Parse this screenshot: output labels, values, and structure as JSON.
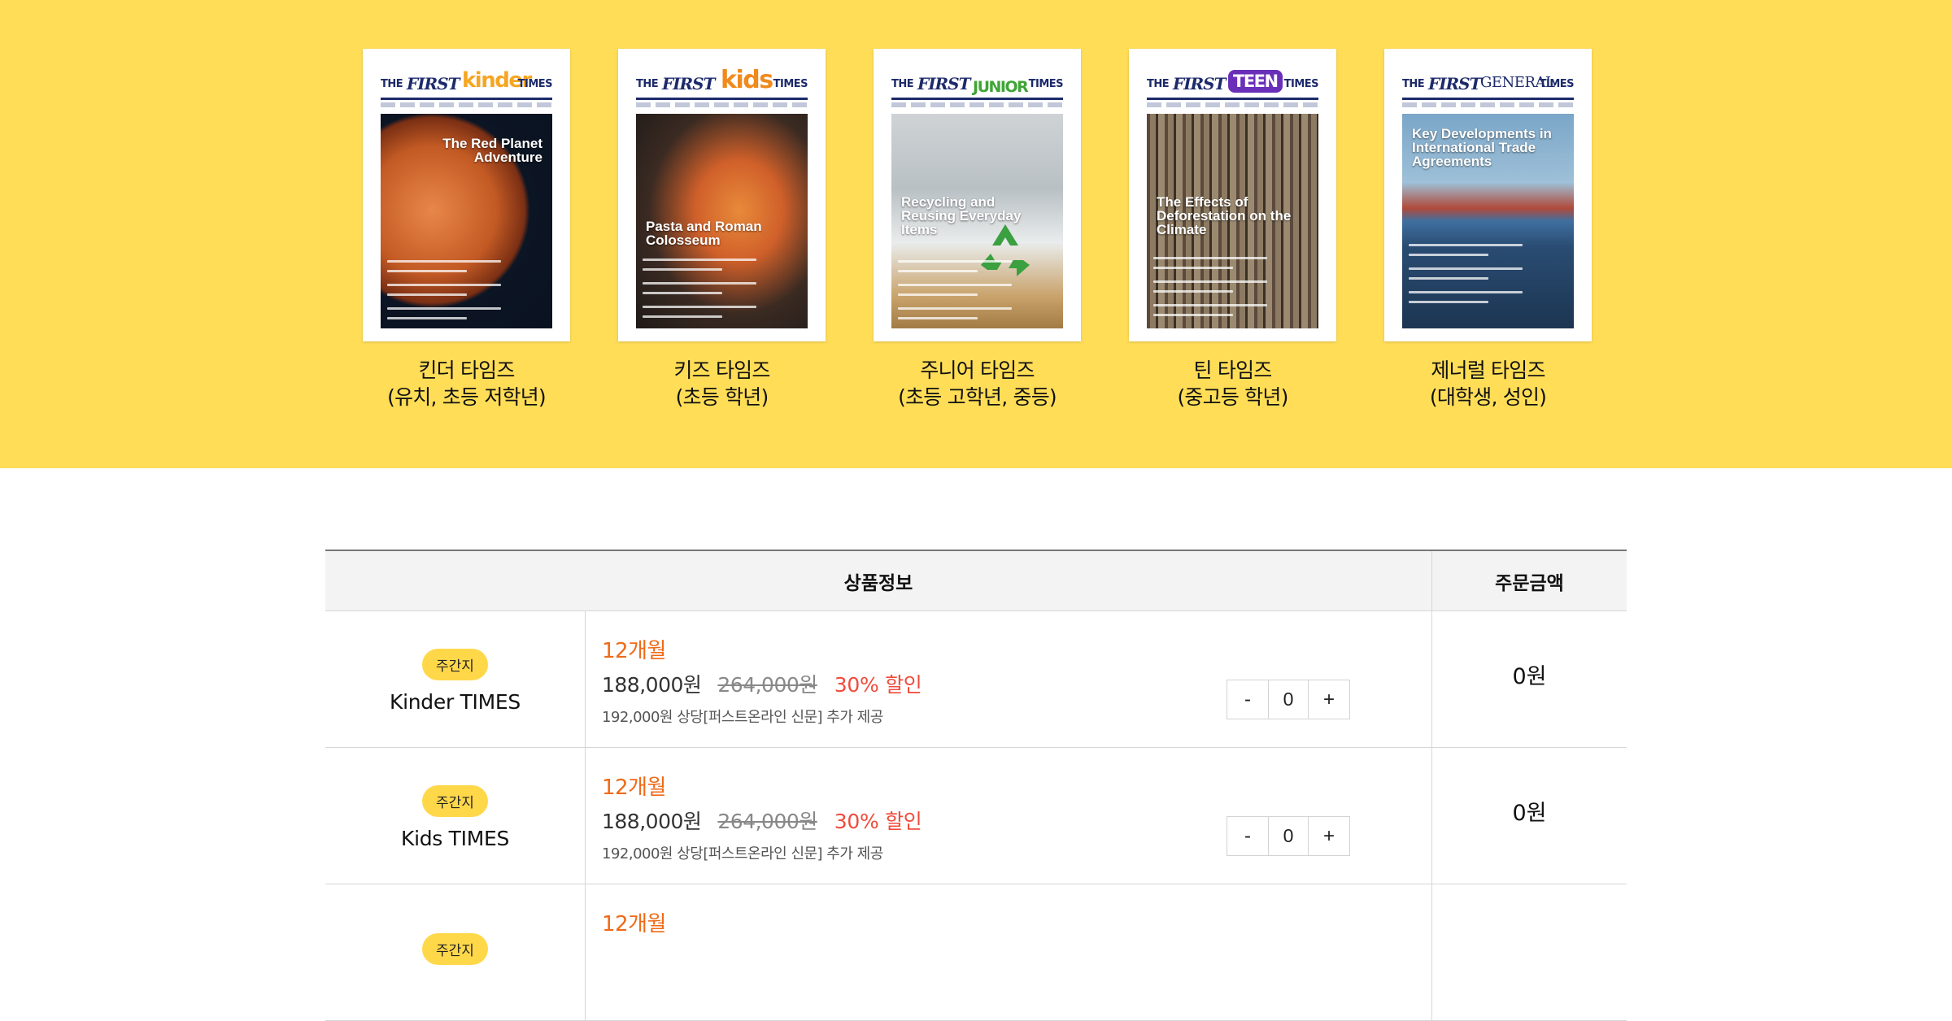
{
  "covers": [
    {
      "brand": "kinder",
      "brand_color": "#f5a623",
      "headline": "The Red Planet Adventure",
      "name": "킨더 타임즈",
      "audience": "(유치, 초등 저학년)"
    },
    {
      "brand": "kids",
      "brand_color": "#f08a1c",
      "headline": "Pasta and Roman Colosseum",
      "name": "키즈 타임즈",
      "audience": "(초등 학년)"
    },
    {
      "brand": "JUNIOR",
      "brand_color": "#3fa535",
      "headline": "Recycling and Reusing Everyday Items",
      "name": "주니어 타임즈",
      "audience": "(초등 고학년, 중등)"
    },
    {
      "brand": "TEEN",
      "brand_color": "#6a2fb8",
      "headline": "The Effects of Deforestation on the Climate",
      "name": "틴 타임즈",
      "audience": "(중고등 학년)"
    },
    {
      "brand": "GENERAL",
      "brand_color": "#1d2a6b",
      "headline": "Key Developments in International Trade Agreements",
      "name": "제너럴 타임즈",
      "audience": "(대학생, 성인)"
    }
  ],
  "masthead": {
    "the": "THE",
    "first": "FIRST",
    "times": "TIMES"
  },
  "table": {
    "col_info": "상품정보",
    "col_price": "주문금액",
    "rows": [
      {
        "badge": "주간지",
        "name": "Kinder TIMES",
        "plan": "12개월",
        "price": "188,000원",
        "original_price": "264,000원",
        "discount": "30% 할인",
        "bonus": "192,000원 상당[퍼스트온라인 신문] 추가 제공",
        "qty": "0",
        "total": "0원",
        "minus": "-",
        "plus": "+"
      },
      {
        "badge": "주간지",
        "name": "Kids TIMES",
        "plan": "12개월",
        "price": "188,000원",
        "original_price": "264,000원",
        "discount": "30% 할인",
        "bonus": "192,000원 상당[퍼스트온라인 신문] 추가 제공",
        "qty": "0",
        "total": "0원",
        "minus": "-",
        "plus": "+"
      },
      {
        "badge": "주간지",
        "name": "",
        "plan": "12개월",
        "price": "",
        "original_price": "",
        "discount": "",
        "bonus": "",
        "qty": "",
        "total": "",
        "minus": "",
        "plus": ""
      }
    ]
  },
  "colors": {
    "hero_bg": "#ffdd57",
    "accent_orange": "#ef6a17",
    "discount_red": "#f04b3c",
    "badge_yellow": "#ffd84a"
  }
}
